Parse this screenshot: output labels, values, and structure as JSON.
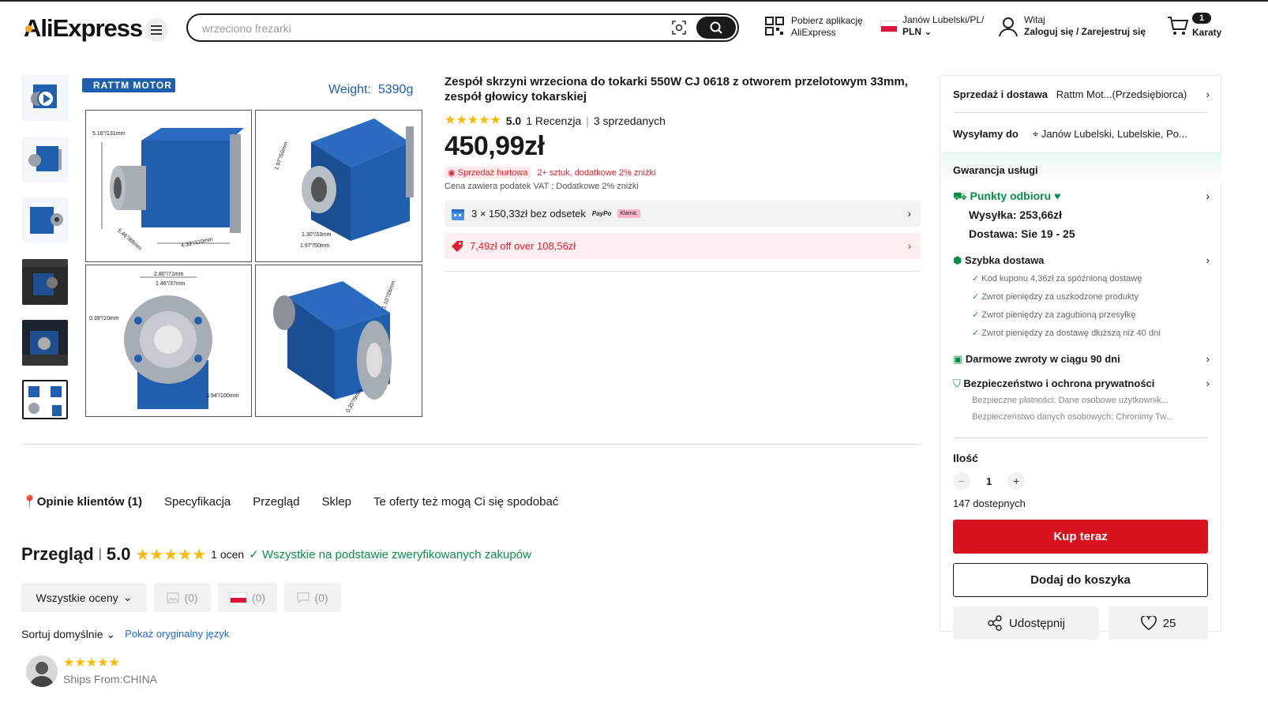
{
  "header": {
    "logo": "AliExpress",
    "search_placeholder": "wrzeciono frezarki",
    "app_line1": "Pobierz aplikację",
    "app_line2": "AliExpress",
    "region_line1": "Janów Lubelski/PL/",
    "region_line2": "PLN",
    "user_line1": "Witaj",
    "user_line2": "Zaloguj się / Zarejestruj się",
    "cart_count": "1",
    "cart_label": "Karaty"
  },
  "gallery": {
    "brand": "RATTM MOTOR",
    "weight_label": "Weight:",
    "weight_value": "5390g",
    "dims": {
      "d1": "5.16\"/131mm",
      "d2": "5.46\"/88mm",
      "d3": "4.33\"/110mm",
      "d4": "1.97\"/50mm",
      "d5": "1.30\"/33mm",
      "d6": "1.97\"/50mm",
      "d7": "2.80\"/71mm",
      "d8": "1.46\"/37mm",
      "d9": "0.39\"/10mm",
      "d10": "3.94\"/100mm",
      "d11": "1.10\"/28mm",
      "d12": "0.35\"/9mm"
    }
  },
  "product": {
    "title": "Zespół skrzyni wrzeciona do tokarki 550W CJ 0618 z otworem przelotowym 33mm, zespół głowicy tokarskiej",
    "rating": "5.0",
    "reviews": "1 Recenzja",
    "sold": "3 sprzedanych",
    "price": "450,99zł",
    "wholesale_tag": "Sprzedaż hurtowa",
    "wholesale_text": "2+ sztuk, dodatkowe 2% zniżki",
    "vat_note": "Cena zawiera podatek VAT ; Dodatkowe 2% zniżki",
    "installments": "3 × 150,33zł bez odsetek",
    "paypo": "PayPo",
    "klarna": "Klarna.",
    "coupon": "7,49zł off over 108,56zł"
  },
  "tabs": [
    "Opinie klientów (1)",
    "Specyfikacja",
    "Przegląd",
    "Sklep",
    "Te oferty też mogą Ci się spodobać"
  ],
  "overview": {
    "title": "Przegląd",
    "score": "5.0",
    "count": "1 ocen",
    "verified": "Wszystkie na podstawie zweryfikowanych zakupów",
    "filter_all": "Wszystkie oceny",
    "filter_photos": "(0)",
    "filter_country": "(0)",
    "filter_comments": "(0)",
    "sort_label": "Sortuj domyślnie",
    "orig_lang": "Pokaż oryginalny język",
    "review_ships": "Ships From:CHINA"
  },
  "panel": {
    "seller_label": "Sprzedaż i dostawa",
    "seller_name": "Rattm Mot...(Przedsiębiorca)",
    "ship_to_label": "Wysyłamy do",
    "ship_to_value": "Janów Lubelski, Lubelskie, Po...",
    "guarantee": "Gwarancja usługi",
    "pickup": "Punkty odbioru",
    "shipping": "Wysyłka: 253,66zł",
    "delivery": "Dostawa: Sie 19 - 25",
    "fast": "Szybka dostawa",
    "fast_items": [
      "Kod kuponu 4,36zł za spóźnioną dostawę",
      "Zwrot pieniędzy za uszkodzone produkty",
      "Zwrot pieniędzy za zagubioną przesyłkę",
      "Zwrot pieniędzy za dostawę dłuższą niż 40 dni"
    ],
    "returns": "Darmowe zwroty w ciągu 90 dni",
    "security": "Bezpieczeństwo i ochrona prywatności",
    "security_items": [
      "Bezpieczne płatności: Dane osobowe użytkownik...",
      "Bezpieczeństwo danych osobowych: Chronimy Tw..."
    ],
    "qty_label": "Ilość",
    "qty_value": "1",
    "available": "147 dostepnych",
    "buy_now": "Kup teraz",
    "add_to_cart": "Dodaj do koszyka",
    "share": "Udostępnij",
    "likes": "25"
  },
  "colors": {
    "brand_red": "#d9131d",
    "green": "#0a8f4a",
    "star": "#fdb900",
    "product_blue": "#1f5fae"
  }
}
